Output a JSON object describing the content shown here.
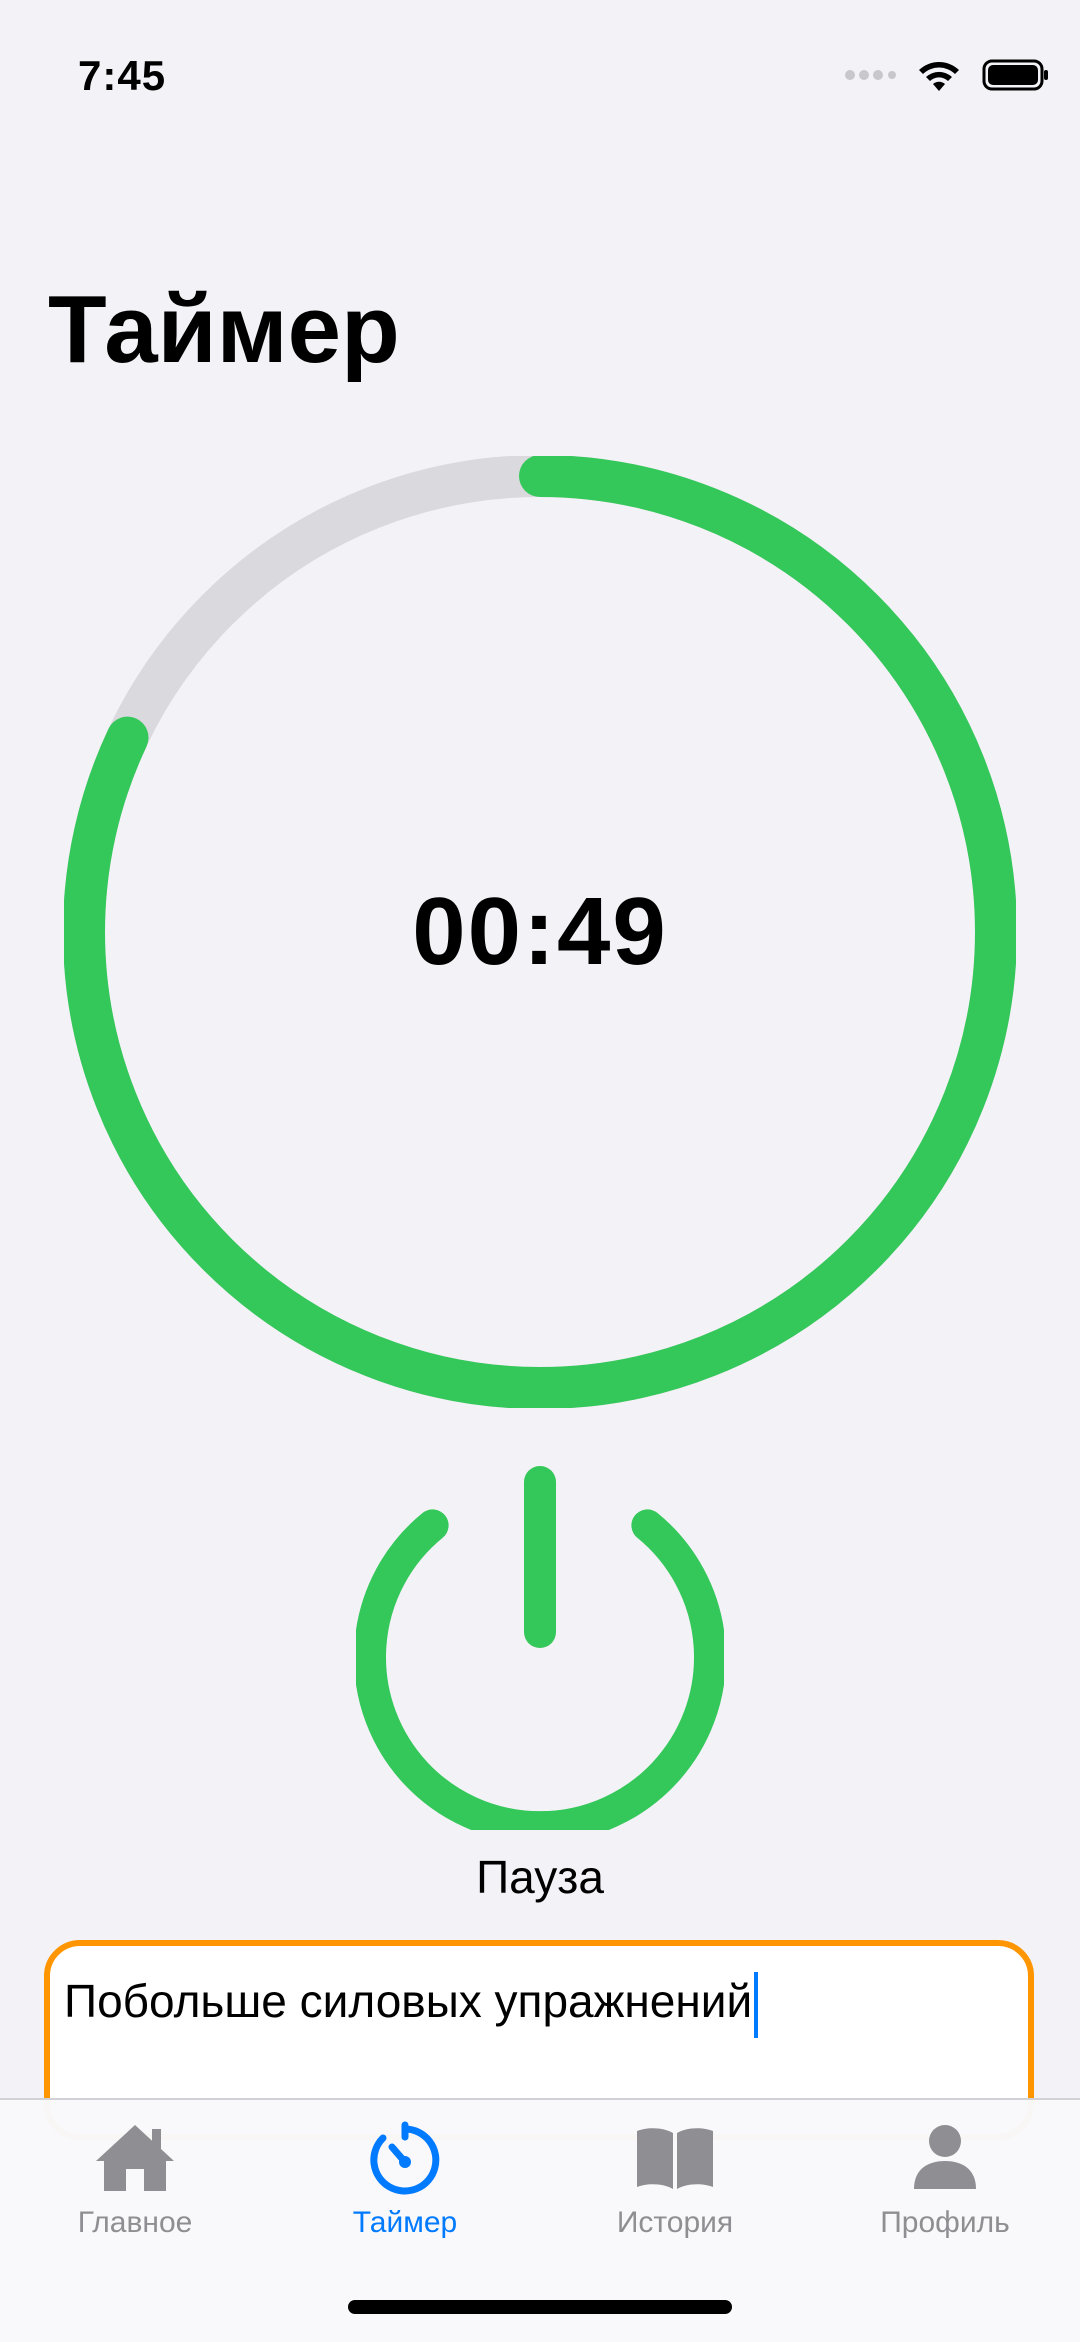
{
  "status_bar": {
    "time": "7:45",
    "icons": [
      "signal-dots-icon",
      "wifi-icon",
      "battery-icon"
    ]
  },
  "title": "Таймер",
  "timer": {
    "display": "00:49",
    "progress": 0.82,
    "colors": {
      "progress": "#34c759",
      "track": "#d9d9de"
    }
  },
  "power_button": {
    "icon": "power-icon",
    "color": "#34c759"
  },
  "pause_label": "Пауза",
  "note": {
    "value": "Побольше силовых упражнений",
    "border_color": "#ff9500"
  },
  "tab_bar": {
    "active_color": "#007aff",
    "inactive_color": "#8e8e93",
    "items": [
      {
        "label": "Главное",
        "icon": "house-icon",
        "active": false
      },
      {
        "label": "Таймер",
        "icon": "timer-icon",
        "active": true
      },
      {
        "label": "История",
        "icon": "book-icon",
        "active": false
      },
      {
        "label": "Профиль",
        "icon": "person-icon",
        "active": false
      }
    ]
  }
}
